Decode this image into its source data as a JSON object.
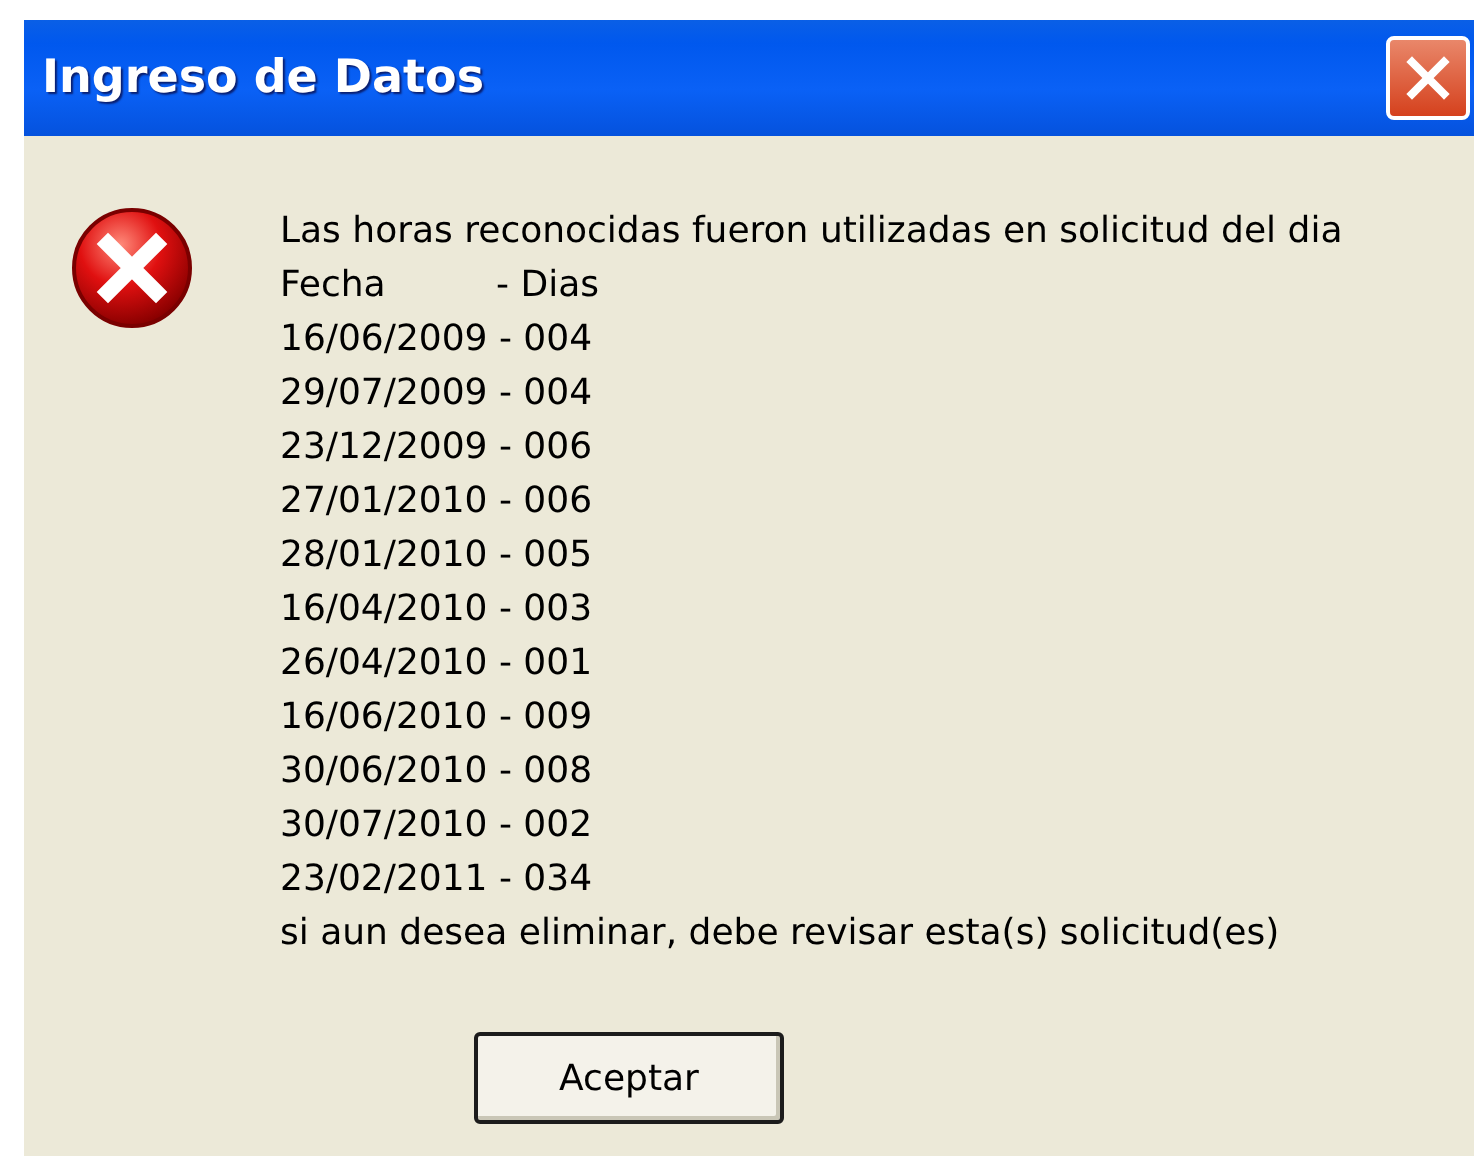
{
  "window": {
    "title": "Ingreso de Datos"
  },
  "message": {
    "intro": "Las horas reconocidas fueron utilizadas en solicitud del dia",
    "header": [
      "Fecha",
      "- Dias"
    ],
    "rows": [
      "16/06/2009 - 004",
      "29/07/2009 - 004",
      "23/12/2009 - 006",
      "27/01/2010 - 006",
      "28/01/2010 - 005",
      "16/04/2010 - 003",
      "26/04/2010 - 001",
      "16/06/2010 - 009",
      "30/06/2010 - 008",
      "30/07/2010 - 002",
      "23/02/2011 - 034"
    ],
    "outro": "si aun desea eliminar, debe revisar esta(s) solicitud(es)"
  },
  "buttons": [
    "Aceptar"
  ]
}
